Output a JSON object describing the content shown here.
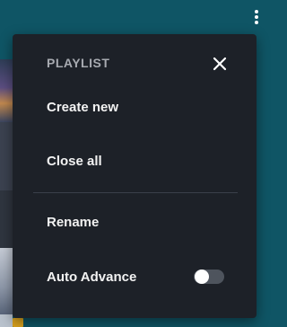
{
  "menu": {
    "title": "PLAYLIST",
    "close_icon": "close-icon",
    "items": [
      {
        "label": "Create new"
      },
      {
        "label": "Close all"
      },
      {
        "label": "Rename"
      },
      {
        "label": "Auto Advance",
        "toggle_on": false
      }
    ]
  },
  "toolbar": {
    "more_icon": "more-vertical-icon"
  },
  "colors": {
    "background": "#0f5565",
    "menu_bg": "#1d2128",
    "title": "#a7aab0",
    "item_text": "#f2f2f2",
    "toggle_track": "#4e545d"
  }
}
